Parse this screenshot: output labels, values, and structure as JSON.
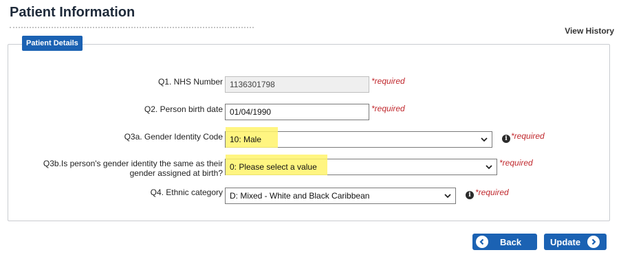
{
  "page_title": "Patient Information",
  "view_history": "View History",
  "panel_tab": "Patient Details",
  "fields": {
    "nhs": {
      "label": "Q1. NHS Number",
      "value": "1136301798",
      "required": "*required"
    },
    "birth": {
      "label": "Q2. Person birth date",
      "value": "01/04/1990",
      "required": "*required"
    },
    "gender": {
      "label": "Q3a. Gender Identity Code",
      "value": "10: Male",
      "required": "*required"
    },
    "gender_same": {
      "label_line1": "Q3b.Is person's gender identity the same as their",
      "label_line2": "gender assigned at birth?",
      "value": "0: Please select a value",
      "required": "*required"
    },
    "ethnic": {
      "label": "Q4. Ethnic category",
      "value": "D: Mixed - White and Black Caribbean",
      "required": "*required"
    }
  },
  "buttons": {
    "back": "Back",
    "update": "Update"
  },
  "colors": {
    "accent": "#1b62b3",
    "required": "#c0282d",
    "highlight": "#fff36b"
  },
  "icons": {
    "info": "info-icon",
    "dropdown": "chevron-down-icon",
    "back": "chevron-left-circle-icon",
    "update": "chevron-right-circle-icon"
  }
}
